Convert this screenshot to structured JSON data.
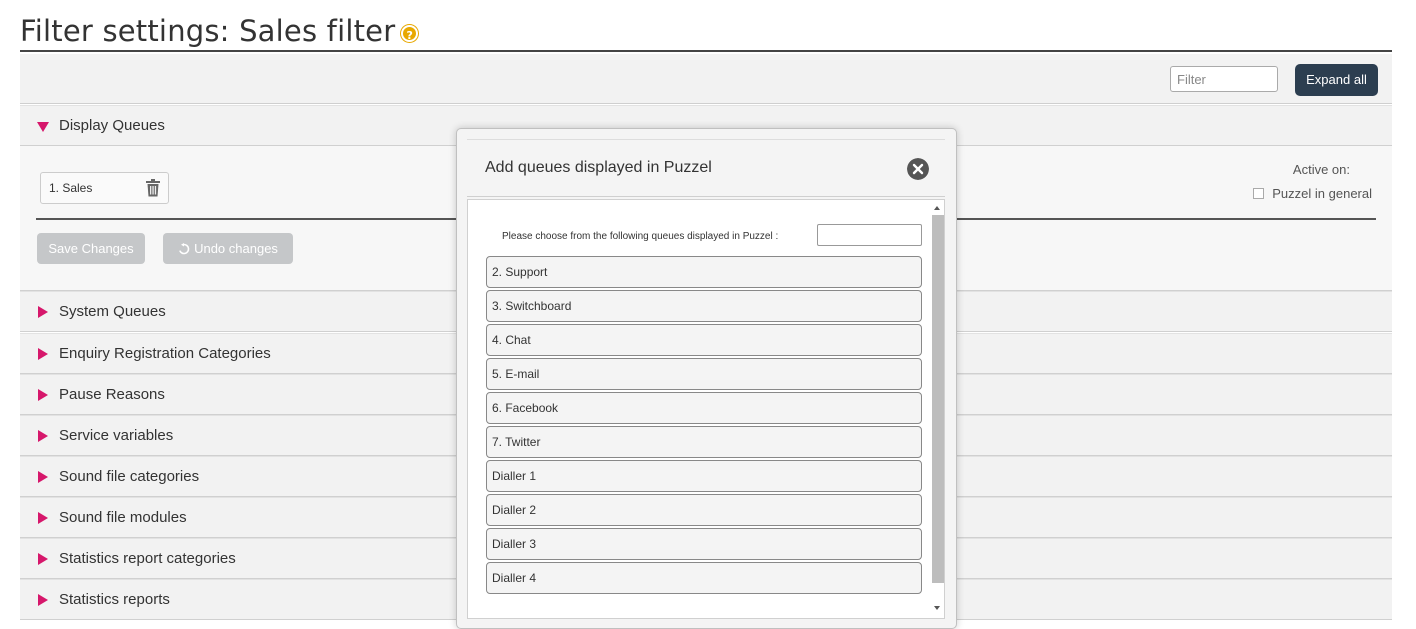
{
  "page": {
    "title": "Filter settings: Sales filter",
    "help_icon_label": "?"
  },
  "toolbar": {
    "filter_placeholder": "Filter",
    "expand_all_label": "Expand all"
  },
  "display_queues": {
    "label": "Display Queues",
    "expanded": true,
    "queue_chip": "1. Sales",
    "save_label": "Save Changes",
    "undo_label": "Undo changes",
    "active_on_label": "Active on:",
    "puzzel_general_label": "Puzzel in general"
  },
  "panels": [
    {
      "label": "System Queues"
    },
    {
      "label": "Enquiry Registration Categories"
    },
    {
      "label": "Pause Reasons"
    },
    {
      "label": "Service variables"
    },
    {
      "label": "Sound file categories"
    },
    {
      "label": "Sound file modules"
    },
    {
      "label": "Statistics report categories"
    },
    {
      "label": "Statistics reports"
    }
  ],
  "modal": {
    "title": "Add queues displayed in Puzzel",
    "prompt": "Please choose from the following queues displayed in Puzzel :",
    "queues": [
      "2. Support",
      "3. Switchboard",
      "4. Chat",
      "5. E-mail",
      "6. Facebook",
      "7. Twitter",
      "Dialler 1",
      "Dialler 2",
      "Dialler 3",
      "Dialler 4"
    ]
  },
  "colors": {
    "accent_arrow": "#d6176b",
    "expand_button": "#2c3e50",
    "help_icon": "#e8a800",
    "disabled_button": "#c5c7c9"
  }
}
